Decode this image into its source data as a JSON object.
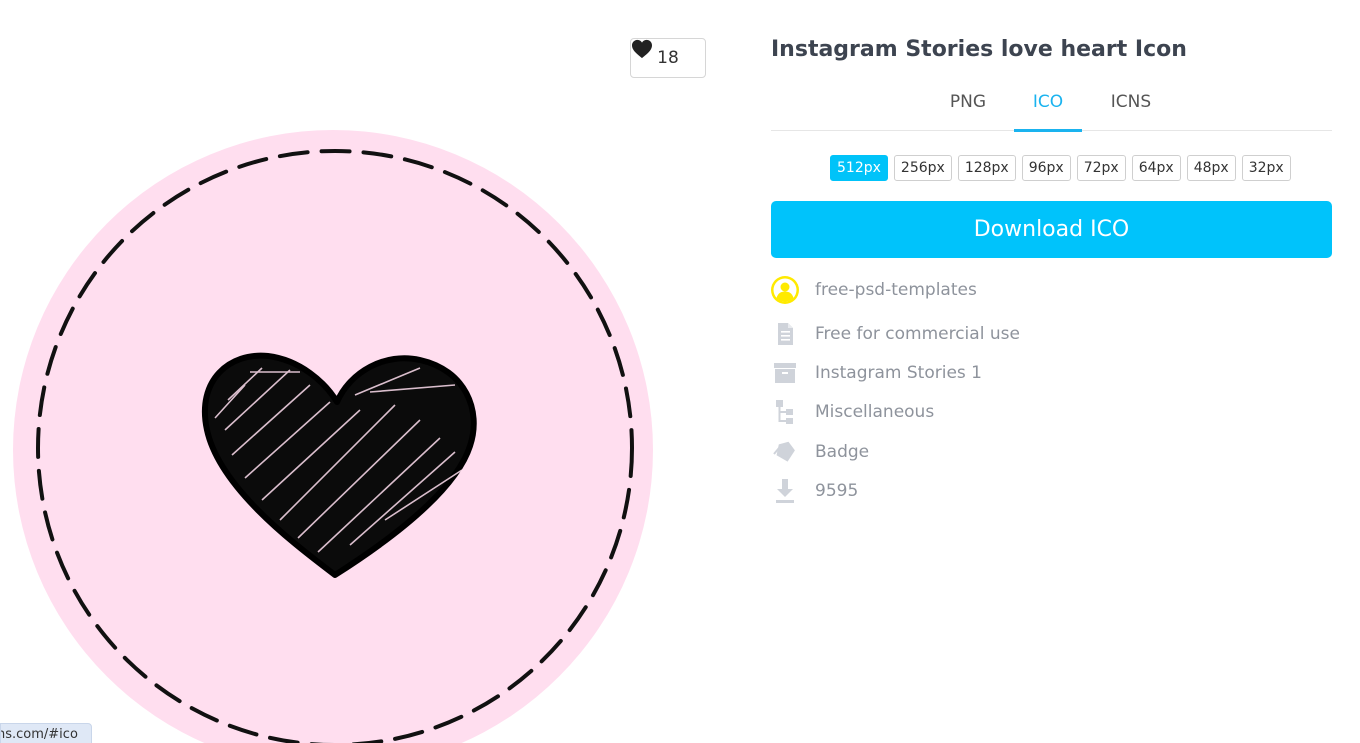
{
  "preview": {
    "like_count": "18",
    "colors": {
      "circle": "#ffdeef",
      "stitch": "#111111",
      "heart": "#0a0a0a"
    }
  },
  "status_bar": {
    "url_text": "ns.com/#ico"
  },
  "title": "Instagram Stories love heart Icon",
  "tabs": [
    {
      "label": "PNG",
      "active": false
    },
    {
      "label": "ICO",
      "active": true
    },
    {
      "label": "ICNS",
      "active": false
    }
  ],
  "sizes": [
    "512px",
    "256px",
    "128px",
    "96px",
    "72px",
    "64px",
    "48px",
    "32px"
  ],
  "selected_size": "512px",
  "download_label": "Download ICO",
  "meta": {
    "author": "free-psd-templates",
    "license": "Free for commercial use",
    "set": "Instagram Stories 1",
    "category": "Miscellaneous",
    "tag": "Badge",
    "downloads": "9595"
  },
  "colors": {
    "accent": "#00c3fb",
    "title": "#3d4450",
    "muted": "#8e939c",
    "author_icon": "#ffea00"
  }
}
